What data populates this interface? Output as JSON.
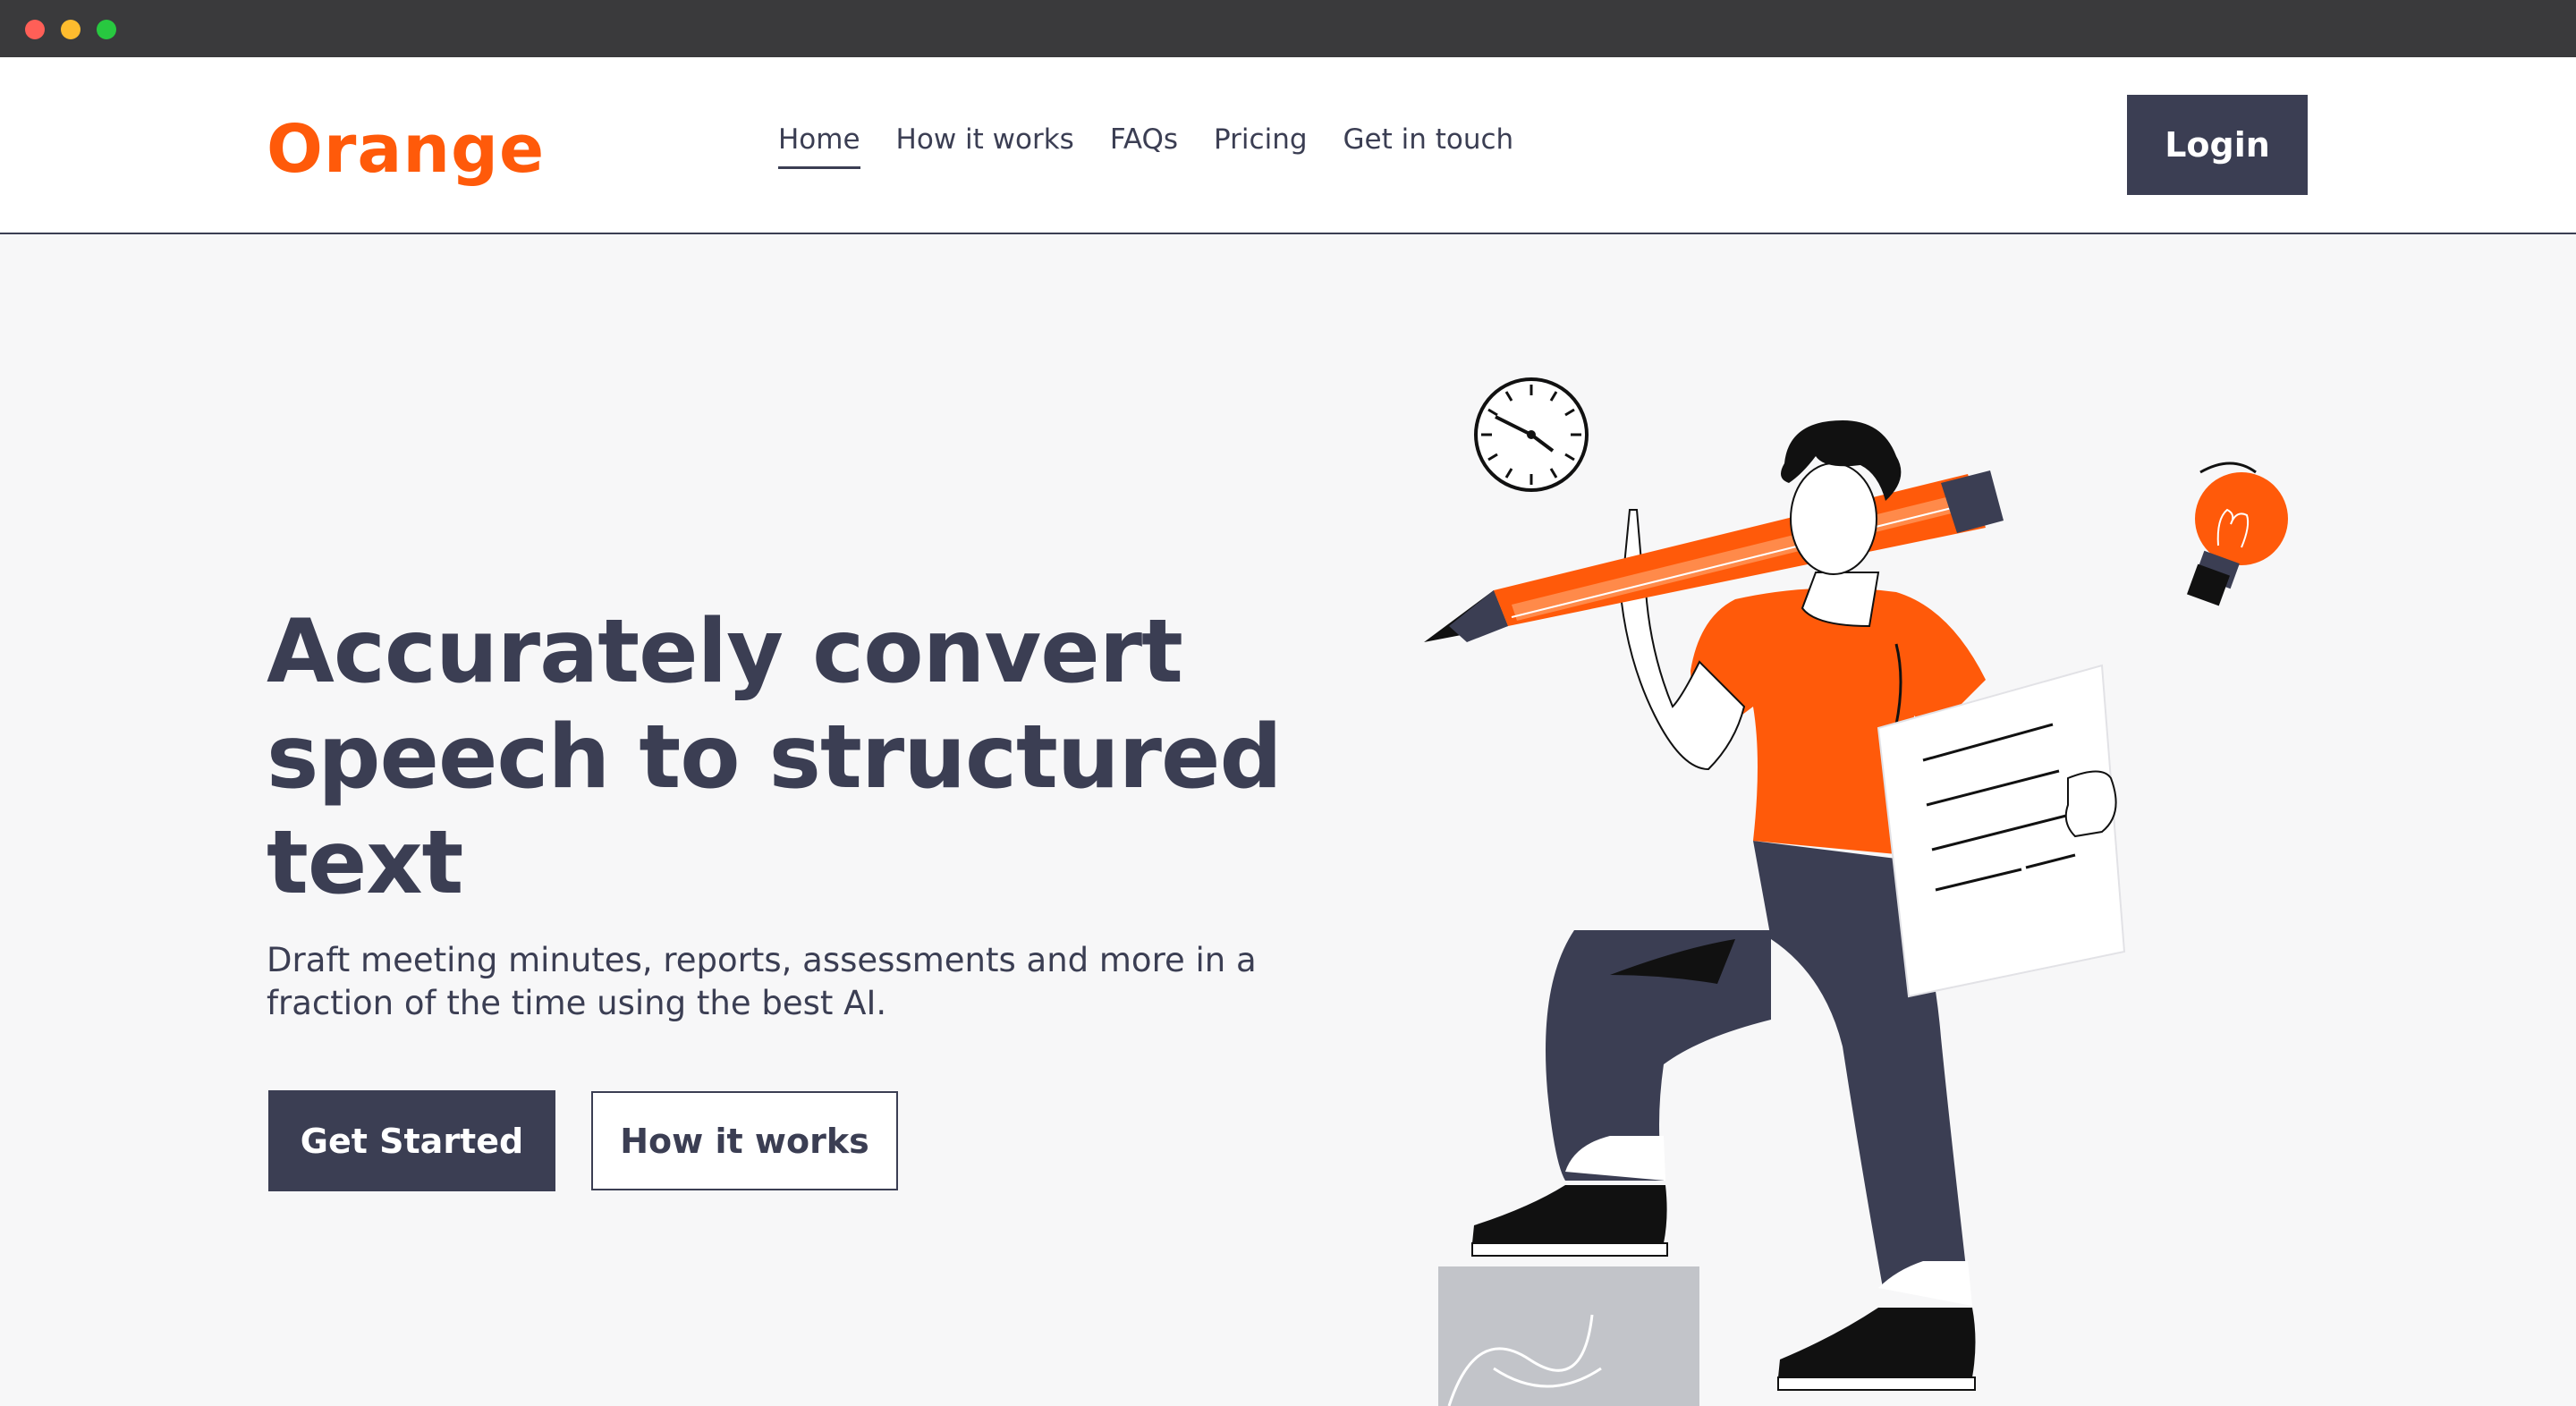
{
  "window": {
    "controls": [
      "close",
      "minimize",
      "maximize"
    ]
  },
  "header": {
    "logo": "Orange",
    "nav": [
      {
        "label": "Home",
        "active": true
      },
      {
        "label": "How it works",
        "active": false
      },
      {
        "label": "FAQs",
        "active": false
      },
      {
        "label": "Pricing",
        "active": false
      },
      {
        "label": "Get in touch",
        "active": false
      }
    ],
    "login_label": "Login"
  },
  "hero": {
    "title": "Accurately convert speech to structured text",
    "subtitle": "Draft meeting minutes, reports, assessments and more in a fraction of the time using the best AI.",
    "primary_cta": "Get Started",
    "secondary_cta": "How it works"
  },
  "illustration": {
    "icons": [
      "clock-icon",
      "lightbulb-icon",
      "pencil-icon",
      "document-icon"
    ]
  },
  "colors": {
    "brand": "#ff5a0a",
    "dark": "#3b3e53",
    "background": "#f7f7f8",
    "header_bg": "#ffffff"
  }
}
